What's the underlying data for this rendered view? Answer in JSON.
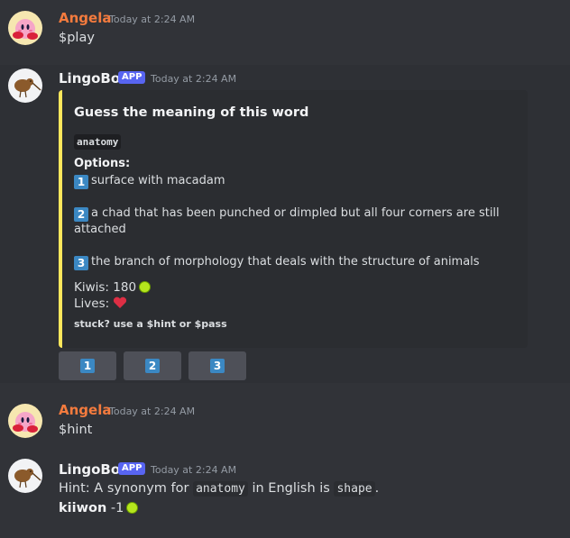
{
  "messages": [
    {
      "author": "Angela",
      "author_color": "#f47b3e",
      "timestamp": "Today at 2:24 AM",
      "text": "$play",
      "avatar_icon": "kirby-avatar"
    },
    {
      "author": "LingoBot",
      "author_color": "#f2f3f5",
      "badge": "APP",
      "timestamp": "Today at 2:24 AM",
      "avatar_icon": "kiwi-avatar",
      "embed": {
        "accent_color": "#fee75c",
        "title": "Guess the meaning of this word",
        "word": "anatomy",
        "options_label": "Options:",
        "options": [
          {
            "key": "1",
            "text": "surface with macadam"
          },
          {
            "key": "2",
            "text": "a chad that has been punched or dimpled but all four corners are still attached"
          },
          {
            "key": "3",
            "text": "the branch of morphology that deals with the structure of animals"
          }
        ],
        "kiwis_label": "Kiwis: 180",
        "lives_label": "Lives:",
        "footer": "stuck? use a $hint or $pass"
      },
      "buttons": [
        "1",
        "2",
        "3"
      ]
    },
    {
      "author": "Angela",
      "author_color": "#f47b3e",
      "timestamp": "Today at 2:24 AM",
      "text": "$hint",
      "avatar_icon": "kirby-avatar"
    },
    {
      "author": "LingoBot",
      "author_color": "#f2f3f5",
      "badge": "APP",
      "timestamp": "Today at 2:24 AM",
      "avatar_icon": "kiwi-avatar",
      "hint": {
        "prefix": "Hint: A synonym for ",
        "code1": "anatomy",
        "middle": " in English is ",
        "code2": "shape",
        "suffix": "."
      },
      "penalty": {
        "user": "kiiwon",
        "amount": " -1"
      }
    }
  ]
}
